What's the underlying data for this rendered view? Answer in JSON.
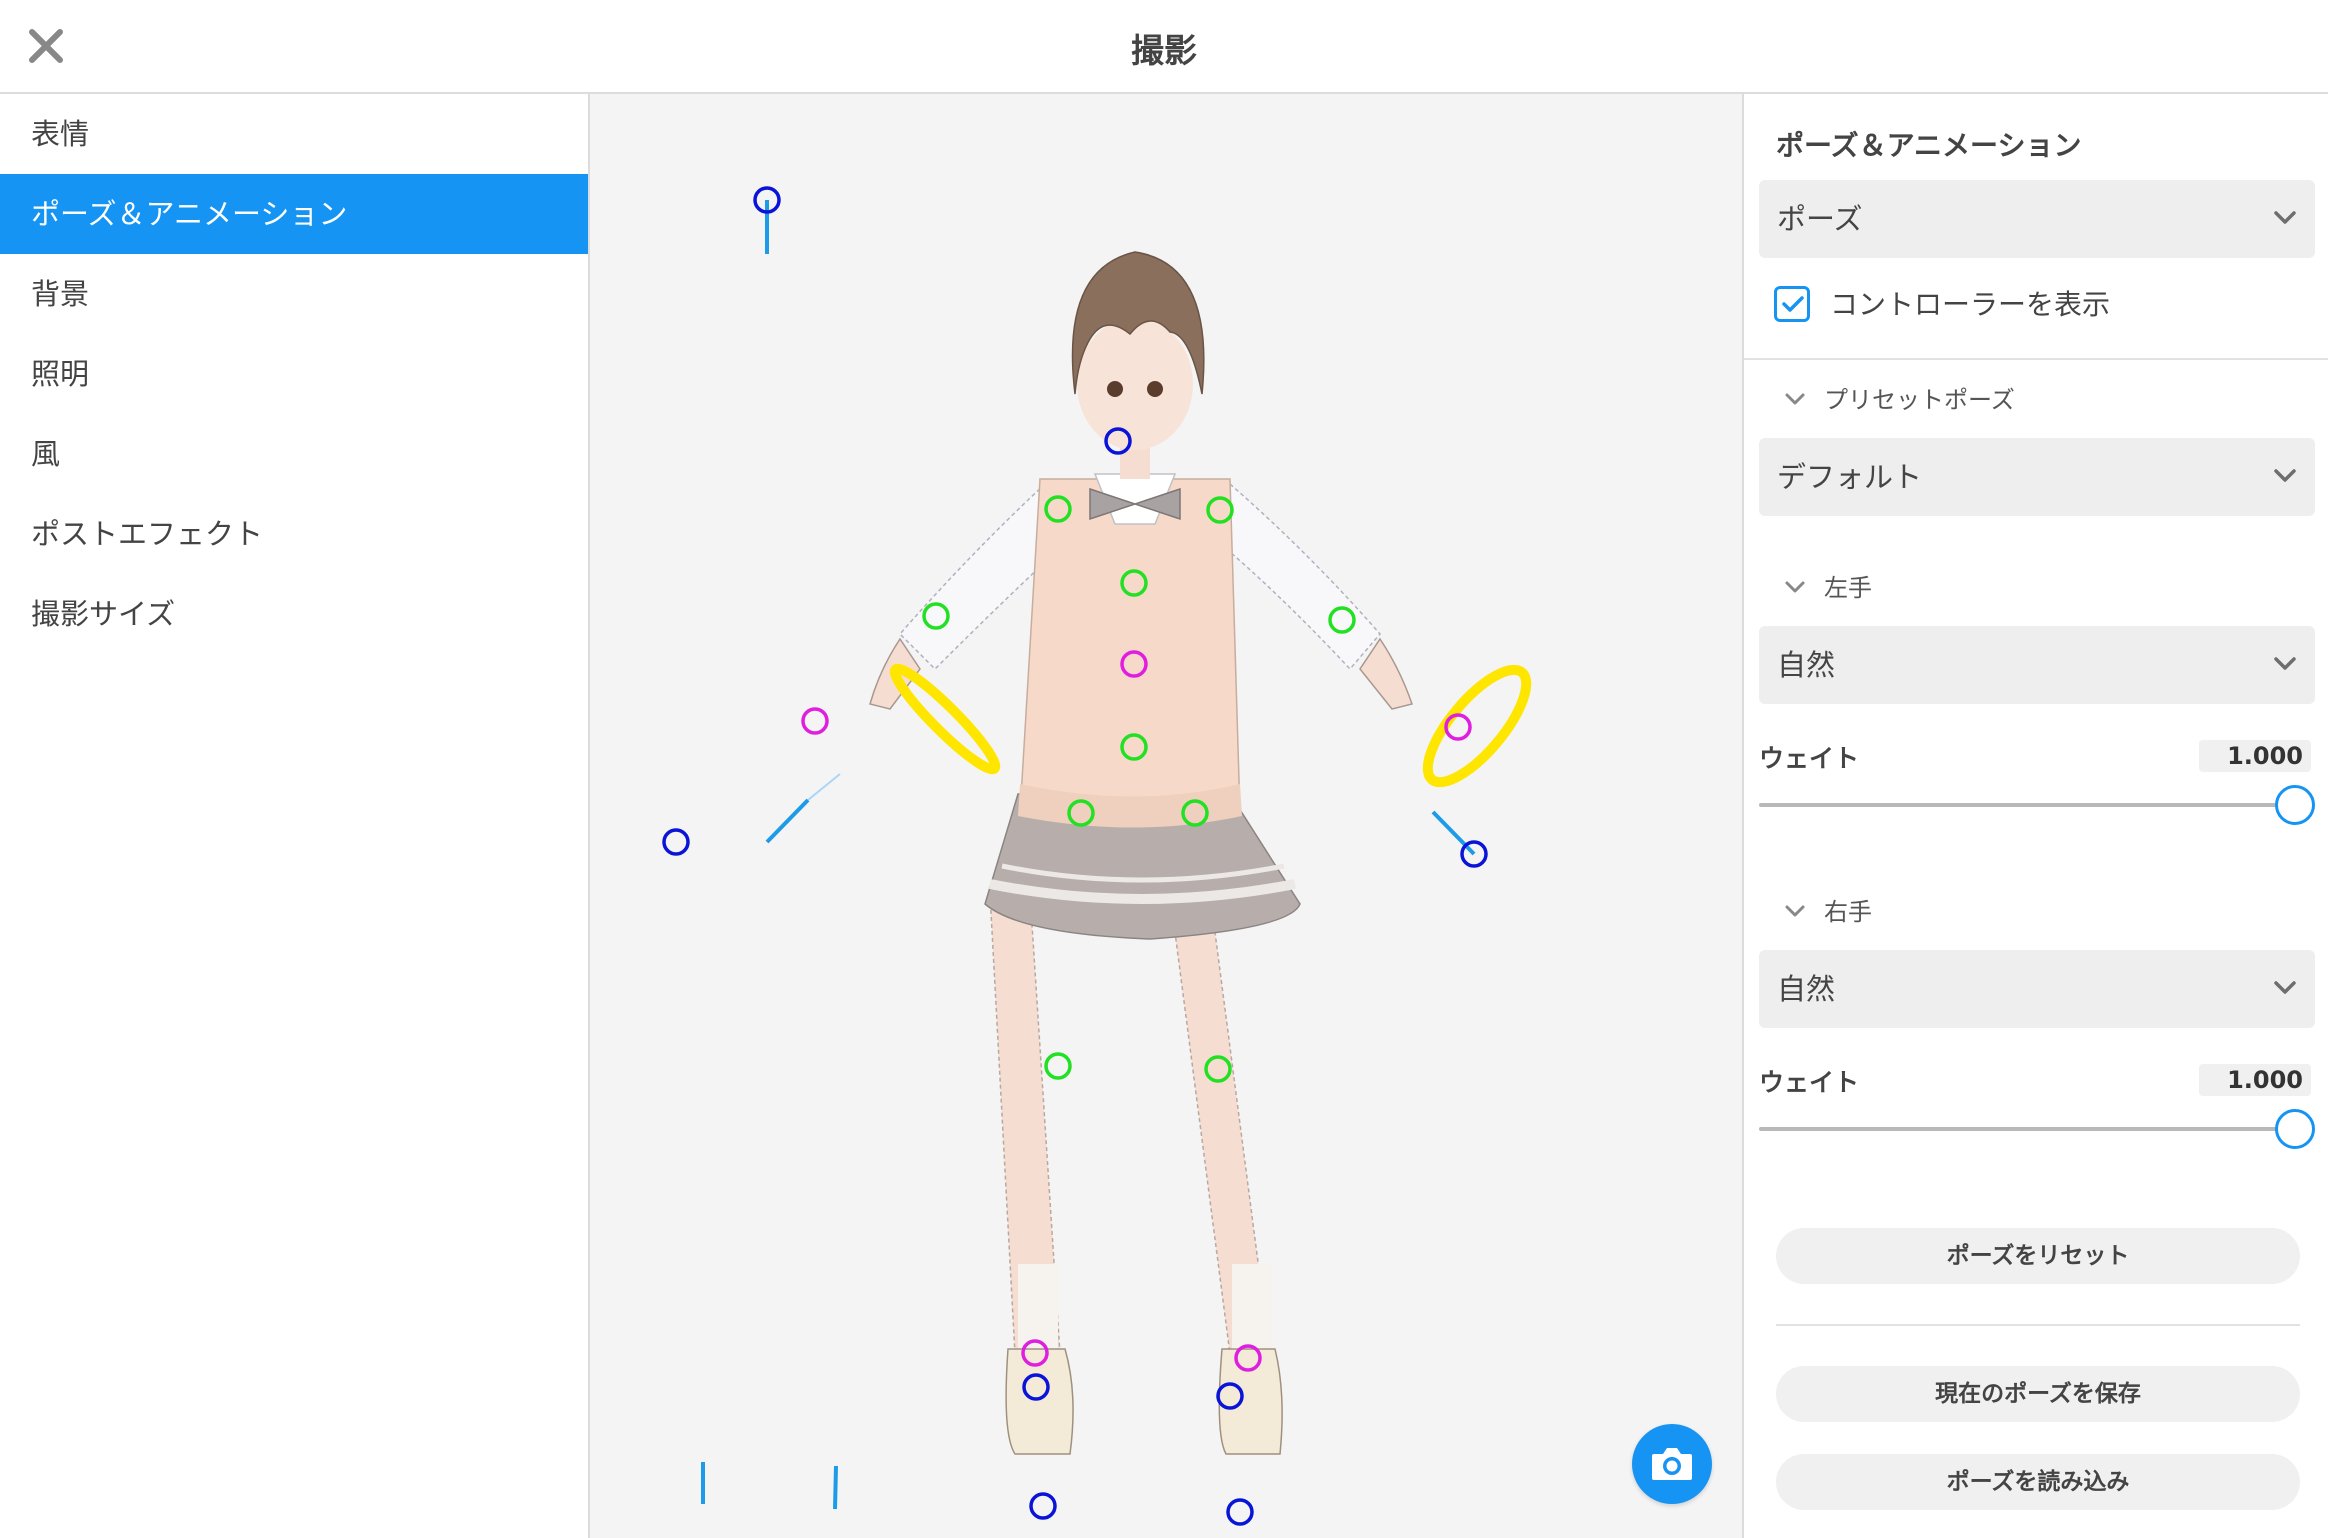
{
  "header": {
    "title": "撮影",
    "close_icon": "close-icon"
  },
  "sidebar": {
    "items": [
      {
        "label": "表情"
      },
      {
        "label": "ポーズ＆アニメーション",
        "active": true
      },
      {
        "label": "背景"
      },
      {
        "label": "照明"
      },
      {
        "label": "風"
      },
      {
        "label": "ポストエフェクト"
      },
      {
        "label": "撮影サイズ"
      }
    ]
  },
  "viewport": {
    "camera_icon": "camera-icon",
    "controller_colors": {
      "root": "#0a14d8",
      "joint": "#22e022",
      "center": "#e01ee0",
      "ring": "#ffe600",
      "bone": "#1e9be8"
    }
  },
  "panel": {
    "heading": "ポーズ＆アニメーション",
    "mode_dropdown": "ポーズ",
    "show_controller": {
      "label": "コントローラーを表示",
      "checked": true
    },
    "preset": {
      "section": "プリセットポーズ",
      "value": "デフォルト"
    },
    "left_hand": {
      "section": "左手",
      "value": "自然",
      "weight_label": "ウェイト",
      "weight": "1.000"
    },
    "right_hand": {
      "section": "右手",
      "value": "自然",
      "weight_label": "ウェイト",
      "weight": "1.000"
    },
    "buttons": {
      "reset": "ポーズをリセット",
      "save": "現在のポーズを保存",
      "load": "ポーズを読み込み"
    }
  },
  "colors": {
    "accent": "#1694f3",
    "sidebar_active_text": "#ffffff"
  }
}
